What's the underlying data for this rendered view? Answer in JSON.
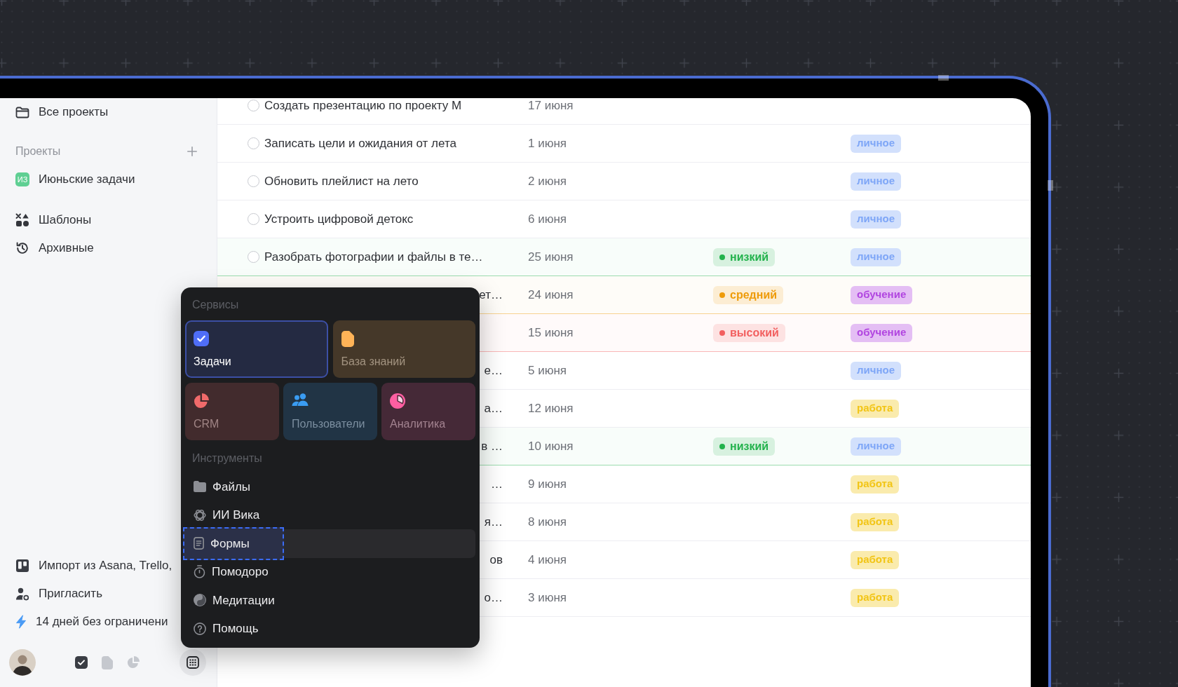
{
  "sidebar": {
    "all_projects": "Все проекты",
    "projects_title": "Проекты",
    "projects": [
      {
        "initials": "ИЗ",
        "name": "Июньские задачи",
        "color": "#5fcf93"
      }
    ],
    "links": [
      "Шаблоны",
      "Архивные"
    ],
    "footer_links": [
      "Импорт из Asana, Trello,",
      "Пригласить",
      "14 дней без ограничени"
    ],
    "app_switcher": [
      {
        "selected": true
      },
      {
        "selected": false
      },
      {
        "selected": false
      }
    ]
  },
  "tasks": [
    {
      "title": "Создать презентацию по проекту М",
      "covered": false,
      "done": false,
      "date": "17 июня"
    },
    {
      "title": "Записать цели и ожидания от лета",
      "covered": false,
      "done": false,
      "date": "1 июня",
      "tag": {
        "label": "личное",
        "color": "#7ea6f7"
      }
    },
    {
      "title": "Обновить плейлист на лето",
      "covered": false,
      "done": false,
      "date": "2 июня",
      "tag": {
        "label": "личное",
        "color": "#7ea6f7"
      }
    },
    {
      "title": "Устроить цифровой детокс",
      "covered": false,
      "done": false,
      "date": "6 июня",
      "tag": {
        "label": "личное",
        "color": "#7ea6f7"
      }
    },
    {
      "title": "Разобрать фотографии и файлы в те…",
      "covered": false,
      "done": false,
      "date": "25 июня",
      "priority": {
        "label": "низкий",
        "color": "#22b24c"
      },
      "tag": {
        "label": "личное",
        "color": "#7ea6f7"
      }
    },
    {
      "title": "ет…",
      "covered": true,
      "date": "24 июня",
      "priority": {
        "label": "средний",
        "color": "#ee9b09"
      },
      "tag": {
        "label": "обучение",
        "color": "#b145e0"
      }
    },
    {
      "date": "15 июня",
      "priority": {
        "label": "высокий",
        "color": "#f25f5f"
      },
      "tag": {
        "label": "обучение",
        "color": "#b145e0"
      }
    },
    {
      "title": "е…",
      "covered": true,
      "date": "5 июня",
      "tag": {
        "label": "личное",
        "color": "#7ea6f7"
      }
    },
    {
      "title": "а…",
      "covered": true,
      "date": "12 июня",
      "tag": {
        "label": "работа",
        "color": "#f2c516"
      }
    },
    {
      "title": "в …",
      "covered": true,
      "date": "10 июня",
      "priority": {
        "label": "низкий",
        "color": "#22b24c"
      },
      "tag": {
        "label": "личное",
        "color": "#7ea6f7"
      }
    },
    {
      "title": "…",
      "covered": true,
      "date": "9 июня",
      "tag": {
        "label": "работа",
        "color": "#f2c516"
      }
    },
    {
      "title": "я…",
      "covered": true,
      "date": "8 июня",
      "tag": {
        "label": "работа",
        "color": "#f2c516"
      }
    },
    {
      "title": "ов",
      "covered": true,
      "date": "4 июня",
      "tag": {
        "label": "работа",
        "color": "#f2c516"
      }
    },
    {
      "title": "о…",
      "covered": true,
      "date": "3 июня",
      "tag": {
        "label": "работа",
        "color": "#f2c516"
      }
    }
  ],
  "menu": {
    "services_title": "Сервисы",
    "services": [
      {
        "label": "Задачи",
        "color": "#4f6ef7",
        "selected": true
      },
      {
        "label": "База знаний",
        "color": "#ffb357",
        "selected": false
      },
      {
        "label": "CRM",
        "color": "#f06a6a",
        "selected": false
      },
      {
        "label": "Пользователи",
        "color": "#3a9cf2",
        "selected": false
      },
      {
        "label": "Аналитика",
        "color": "#ff5fa2",
        "selected": false
      }
    ],
    "tools_title": "Инструменты",
    "tools": [
      {
        "label": "Файлы",
        "selected": false
      },
      {
        "label": "ИИ Вика",
        "selected": false
      },
      {
        "label": "Формы",
        "selected": true
      },
      {
        "label": "Помодоро",
        "selected": false
      },
      {
        "label": "Медитации",
        "selected": false
      },
      {
        "label": "Помощь",
        "selected": false
      }
    ]
  }
}
